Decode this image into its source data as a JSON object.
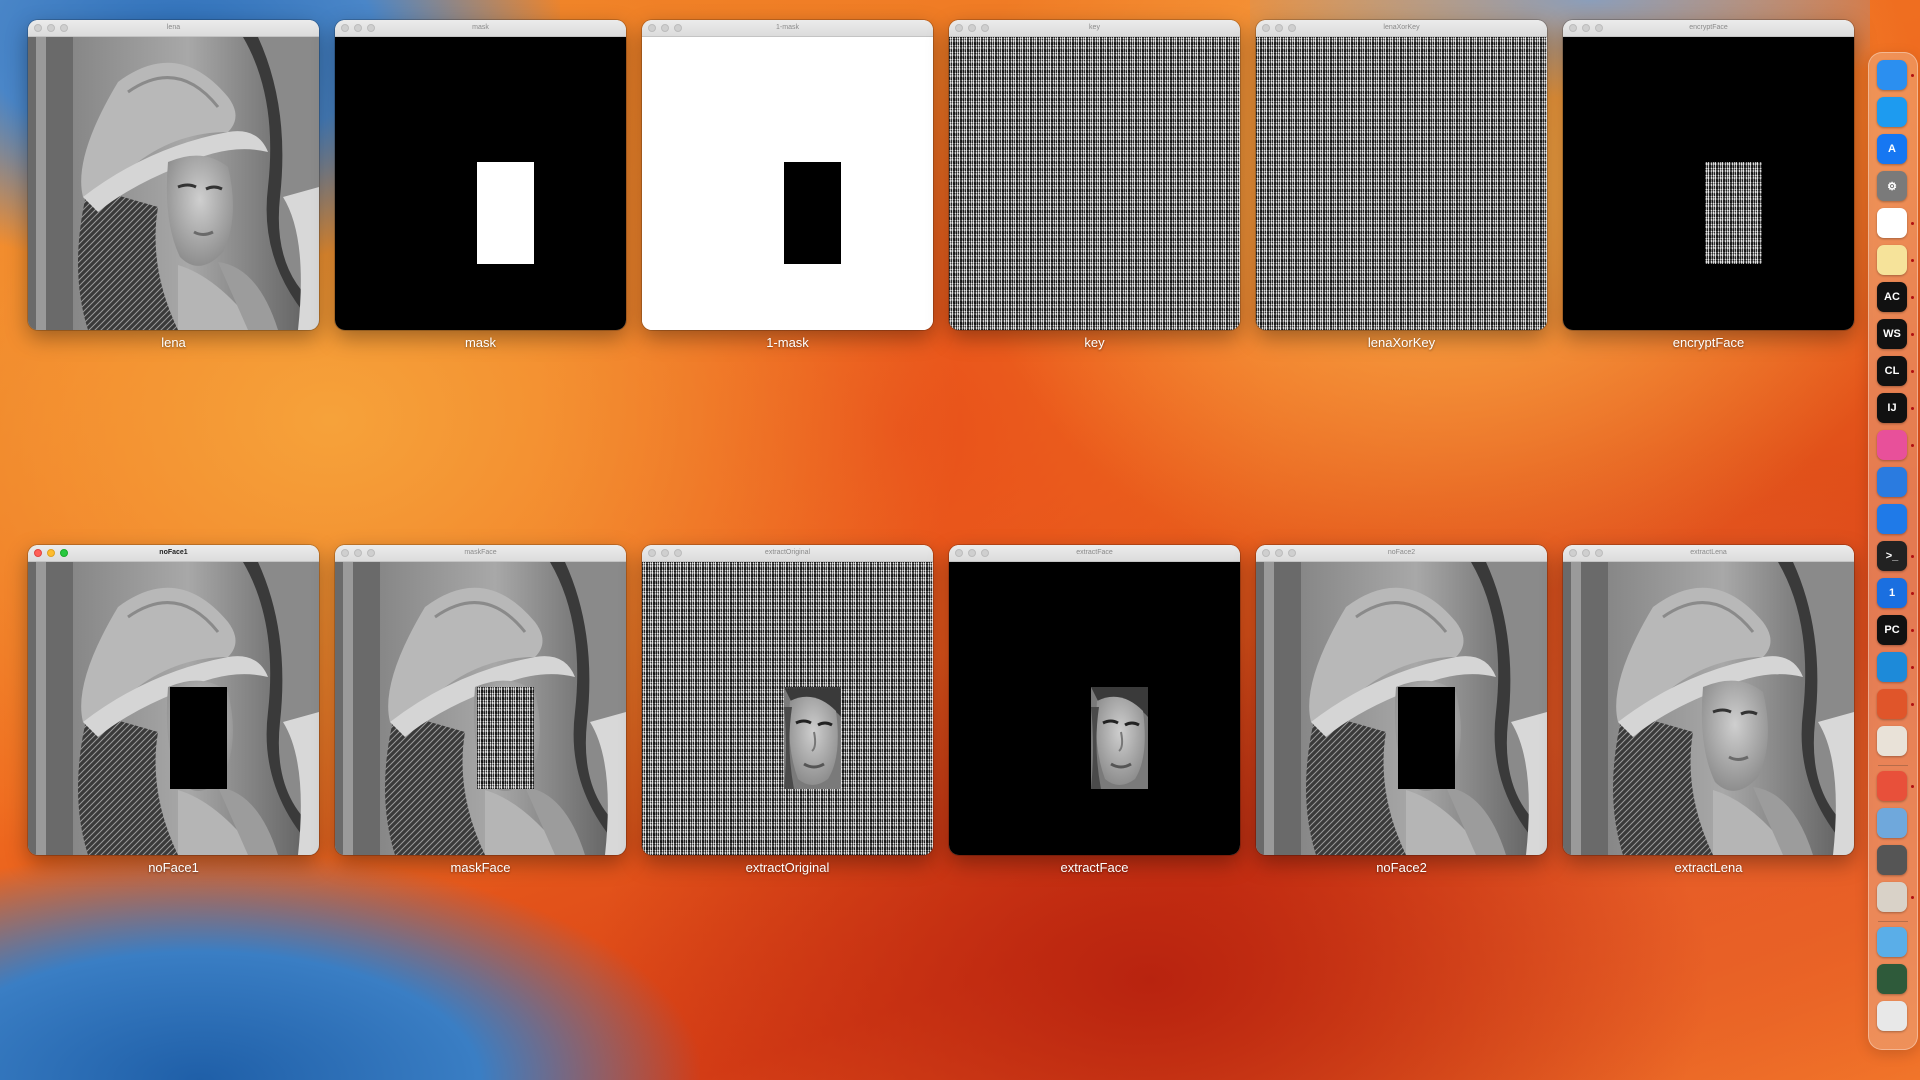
{
  "windows_row1": [
    {
      "title": "lena",
      "caption": "lena"
    },
    {
      "title": "mask",
      "caption": "mask"
    },
    {
      "title": "1-mask",
      "caption": "1-mask"
    },
    {
      "title": "key",
      "caption": "key"
    },
    {
      "title": "lenaXorKey",
      "caption": "lenaXorKey"
    },
    {
      "title": "encryptFace",
      "caption": "encryptFace"
    }
  ],
  "windows_row2": [
    {
      "title": "noFace1",
      "caption": "noFace1"
    },
    {
      "title": "maskFace",
      "caption": "maskFace"
    },
    {
      "title": "extractOriginal",
      "caption": "extractOriginal"
    },
    {
      "title": "extractFace",
      "caption": "extractFace"
    },
    {
      "title": "noFace2",
      "caption": "noFace2"
    },
    {
      "title": "extractLena",
      "caption": "extractLena"
    }
  ],
  "dock": {
    "items": [
      {
        "name": "finder-icon",
        "label": "",
        "color": "#2b8ff0"
      },
      {
        "name": "safari-icon",
        "label": "",
        "color": "#1d9bf0"
      },
      {
        "name": "app-store-icon",
        "label": "A",
        "color": "#1677f2"
      },
      {
        "name": "system-settings-icon",
        "label": "⚙",
        "color": "#7a7a7a"
      },
      {
        "name": "chrome-icon",
        "label": "",
        "color": "#ffffff"
      },
      {
        "name": "notes-icon",
        "label": "",
        "color": "#f6e39a"
      },
      {
        "name": "appcode-icon",
        "label": "AC",
        "color": "#111111"
      },
      {
        "name": "webstorm-icon",
        "label": "WS",
        "color": "#111111"
      },
      {
        "name": "clion-icon",
        "label": "CL",
        "color": "#111111"
      },
      {
        "name": "intellij-icon",
        "label": "IJ",
        "color": "#111111"
      },
      {
        "name": "screens-icon",
        "label": "",
        "color": "#e8509a"
      },
      {
        "name": "xcode-icon",
        "label": "",
        "color": "#2a7be0"
      },
      {
        "name": "cloud-app-icon",
        "label": "",
        "color": "#1f7ae8"
      },
      {
        "name": "terminal-icon",
        "label": ">_",
        "color": "#222222"
      },
      {
        "name": "1password-icon",
        "label": "1",
        "color": "#1a6fe0"
      },
      {
        "name": "pycharm-icon",
        "label": "PC",
        "color": "#111111"
      },
      {
        "name": "vscode-icon",
        "label": "",
        "color": "#1d8ad9"
      },
      {
        "name": "firefox-icon",
        "label": "",
        "color": "#e0552a"
      },
      {
        "name": "launchpad-icon",
        "label": "",
        "color": "#e9e2d8"
      },
      {
        "name": "screen-recorder-icon",
        "label": "",
        "color": "#e8503a"
      },
      {
        "name": "preview-icon",
        "label": "",
        "color": "#6fa8dc"
      },
      {
        "name": "calculator-icon",
        "label": "",
        "color": "#555555"
      },
      {
        "name": "rocket-app-icon",
        "label": "",
        "color": "#d9d2c8"
      },
      {
        "name": "downloads-folder-icon",
        "label": "",
        "color": "#5aaee8"
      },
      {
        "name": "screenshot-thumbnail-icon",
        "label": "",
        "color": "#2e5a3a"
      },
      {
        "name": "trash-icon",
        "label": "",
        "color": "#e8e8e8"
      }
    ]
  }
}
